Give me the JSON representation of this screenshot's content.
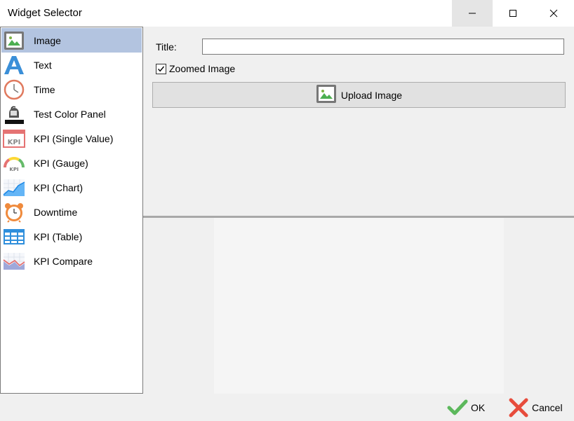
{
  "window": {
    "title": "Widget Selector",
    "controls": {
      "minimize": "minimize-icon",
      "maximize": "maximize-icon",
      "close": "close-icon"
    }
  },
  "widgets": [
    {
      "label": "Image",
      "icon": "image-icon",
      "selected": true
    },
    {
      "label": "Text",
      "icon": "text-icon",
      "selected": false
    },
    {
      "label": "Time",
      "icon": "clock-icon",
      "selected": false
    },
    {
      "label": "Test Color Panel",
      "icon": "paint-bucket-icon",
      "selected": false
    },
    {
      "label": "KPI (Single Value)",
      "icon": "kpi-value-icon",
      "selected": false
    },
    {
      "label": "KPI (Gauge)",
      "icon": "kpi-gauge-icon",
      "selected": false
    },
    {
      "label": "KPI (Chart)",
      "icon": "kpi-chart-icon",
      "selected": false
    },
    {
      "label": "Downtime",
      "icon": "alarm-clock-icon",
      "selected": false
    },
    {
      "label": "KPI (Table)",
      "icon": "table-icon",
      "selected": false
    },
    {
      "label": "KPI Compare",
      "icon": "compare-chart-icon",
      "selected": false
    }
  ],
  "settings": {
    "title_label": "Title:",
    "title_value": "",
    "zoomed_label": "Zoomed Image",
    "zoomed_checked": true,
    "upload_label": "Upload Image"
  },
  "footer": {
    "ok_label": "OK",
    "cancel_label": "Cancel"
  },
  "colors": {
    "selection": "#b3c4e0",
    "ok_green": "#5cb85c",
    "cancel_red": "#e74c3c"
  }
}
